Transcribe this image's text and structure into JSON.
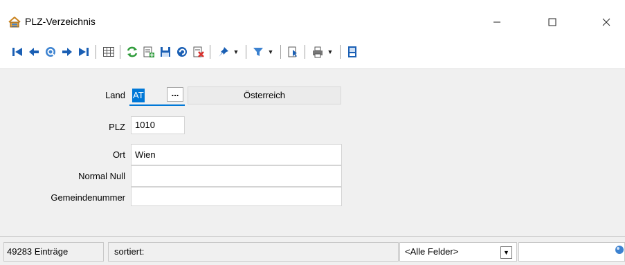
{
  "window": {
    "title": "PLZ-Verzeichnis",
    "min_glyph": "—",
    "max_glyph": "☐",
    "close_glyph": "✕"
  },
  "toolbar": {
    "icons": [
      "first-record-icon",
      "previous-record-icon",
      "search-record-icon",
      "next-record-icon",
      "last-record-icon",
      "table-view-icon",
      "refresh-icon",
      "new-record-icon",
      "save-icon",
      "undo-icon",
      "delete-icon",
      "pin-icon",
      "filter-icon",
      "export-icon",
      "print-icon",
      "exit-icon"
    ]
  },
  "form": {
    "land_label": "Land",
    "land_code": "AT",
    "ellipsis": "...",
    "land_name": "Österreich",
    "plz_label": "PLZ",
    "plz_value": "1010",
    "ort_label": "Ort",
    "ort_value": "Wien",
    "normal_null_label": "Normal Null",
    "normal_null_value": "",
    "gemeinde_label": "Gemeindenummer",
    "gemeinde_value": ""
  },
  "status": {
    "count": "49283 Einträge",
    "sort_label": "sortiert:",
    "field_filter": "<Alle Felder>",
    "search_value": ""
  },
  "colors": {
    "nav_blue": "#1a5fb4",
    "selection": "#0078d7",
    "refresh_green": "#2e9b3a",
    "delete_red": "#d9302c",
    "panel_bg": "#f0f0f0"
  }
}
